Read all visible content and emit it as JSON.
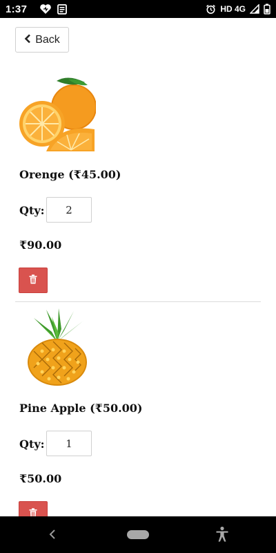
{
  "status_bar": {
    "time": "1:37",
    "network_label": "HD 4G",
    "left_icons": [
      "heart-icon",
      "news-icon"
    ],
    "right_icons": [
      "alarm-icon",
      "signal-icon",
      "battery-icon"
    ]
  },
  "back_button": {
    "label": "Back",
    "icon": "chevron-left-icon"
  },
  "cart_items": [
    {
      "name": "Orenge (₹45.00)",
      "image": "orange-fruit",
      "qty_label": "Qty:",
      "qty_value": "2",
      "total": "₹90.00",
      "delete_icon": "trash-icon"
    },
    {
      "name": "Pine Apple (₹50.00)",
      "image": "pineapple-fruit",
      "qty_label": "Qty:",
      "qty_value": "1",
      "total": "₹50.00",
      "delete_icon": "trash-icon"
    }
  ],
  "nav_bar": {
    "icons": [
      "back-triangle-icon",
      "home-pill-icon",
      "accessibility-icon"
    ]
  },
  "colors": {
    "delete_button": "#d9534f",
    "status_bar": "#000000",
    "nav_bar": "#000000"
  }
}
